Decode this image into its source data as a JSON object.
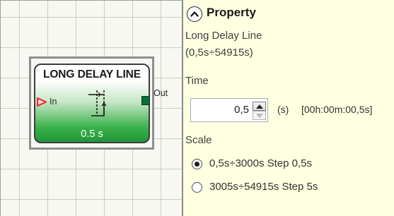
{
  "block": {
    "title": "LONG DELAY LINE",
    "input_label": "In",
    "output_label": "Out",
    "value_label": "0.5 s",
    "colors": {
      "input_pin": "#e8202c",
      "output_pin": "#0b6b3a",
      "body_gradient_end": "#22963a"
    }
  },
  "panel": {
    "title": "Property",
    "collapse_icon": "chevron-up-icon",
    "description_line1": "Long Delay Line",
    "description_line2": "(0,5s÷54915s)",
    "time_label": "Time",
    "time_value": "0,5",
    "time_unit": "(s)",
    "time_formatted": "[00h:00m:00,5s]",
    "scale_label": "Scale",
    "scale_options": [
      {
        "label": "0,5s÷3000s Step 0,5s",
        "selected": true
      },
      {
        "label": "3005s÷54915s Step 5s",
        "selected": false
      }
    ],
    "background_color": "#ffffe1"
  }
}
